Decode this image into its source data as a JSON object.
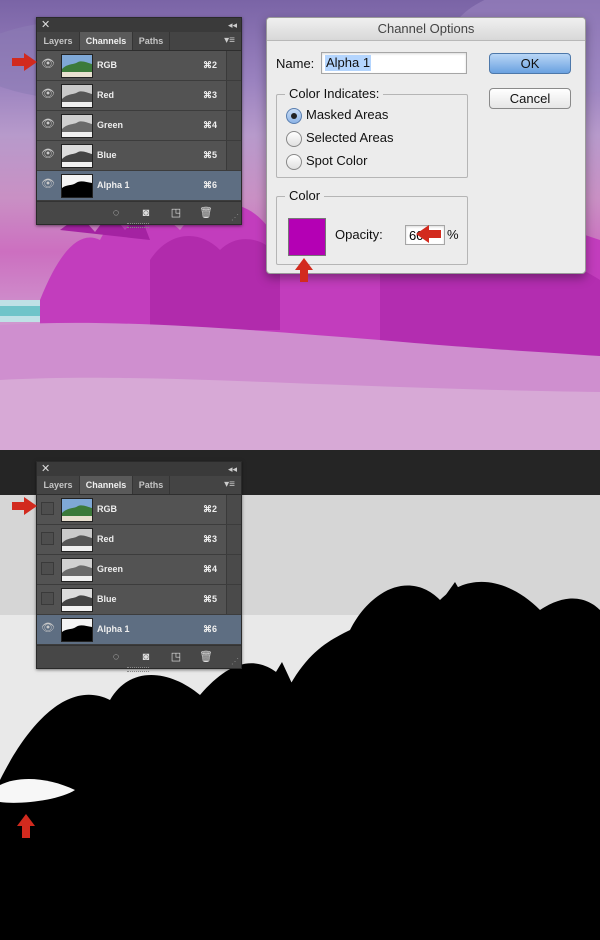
{
  "colors": {
    "mask": "#b400b4",
    "panel_bg": "#535353",
    "selected_row": "#5e6e82",
    "arrow": "#d22a1e"
  },
  "panel_top": {
    "tabs": [
      "Layers",
      "Channels",
      "Paths"
    ],
    "active_tab": "Channels",
    "rows": [
      {
        "name": "RGB",
        "shortcut": "⌘2",
        "visible": true
      },
      {
        "name": "Red",
        "shortcut": "⌘3",
        "visible": true
      },
      {
        "name": "Green",
        "shortcut": "⌘4",
        "visible": true
      },
      {
        "name": "Blue",
        "shortcut": "⌘5",
        "visible": true
      },
      {
        "name": "Alpha 1",
        "shortcut": "⌘6",
        "visible": true,
        "selected": true
      }
    ]
  },
  "panel_bottom": {
    "tabs": [
      "Layers",
      "Channels",
      "Paths"
    ],
    "active_tab": "Channels",
    "rows": [
      {
        "name": "RGB",
        "shortcut": "⌘2",
        "visible": false
      },
      {
        "name": "Red",
        "shortcut": "⌘3",
        "visible": false
      },
      {
        "name": "Green",
        "shortcut": "⌘4",
        "visible": false
      },
      {
        "name": "Blue",
        "shortcut": "⌘5",
        "visible": false
      },
      {
        "name": "Alpha 1",
        "shortcut": "⌘6",
        "visible": true,
        "selected": true
      }
    ]
  },
  "icons": {
    "close": "close-icon",
    "collapse": "collapse-icon",
    "menu": "panel-menu-icon",
    "eye": "eye-icon"
  },
  "dialog": {
    "title": "Channel Options",
    "name_label": "Name:",
    "name_value": "Alpha 1",
    "color_indicates_label": "Color Indicates:",
    "options": [
      "Masked Areas",
      "Selected Areas",
      "Spot Color"
    ],
    "selected_option": "Masked Areas",
    "color_label": "Color",
    "opacity_label": "Opacity:",
    "opacity_value": "60",
    "opacity_unit": "%",
    "ok_label": "OK",
    "cancel_label": "Cancel"
  }
}
